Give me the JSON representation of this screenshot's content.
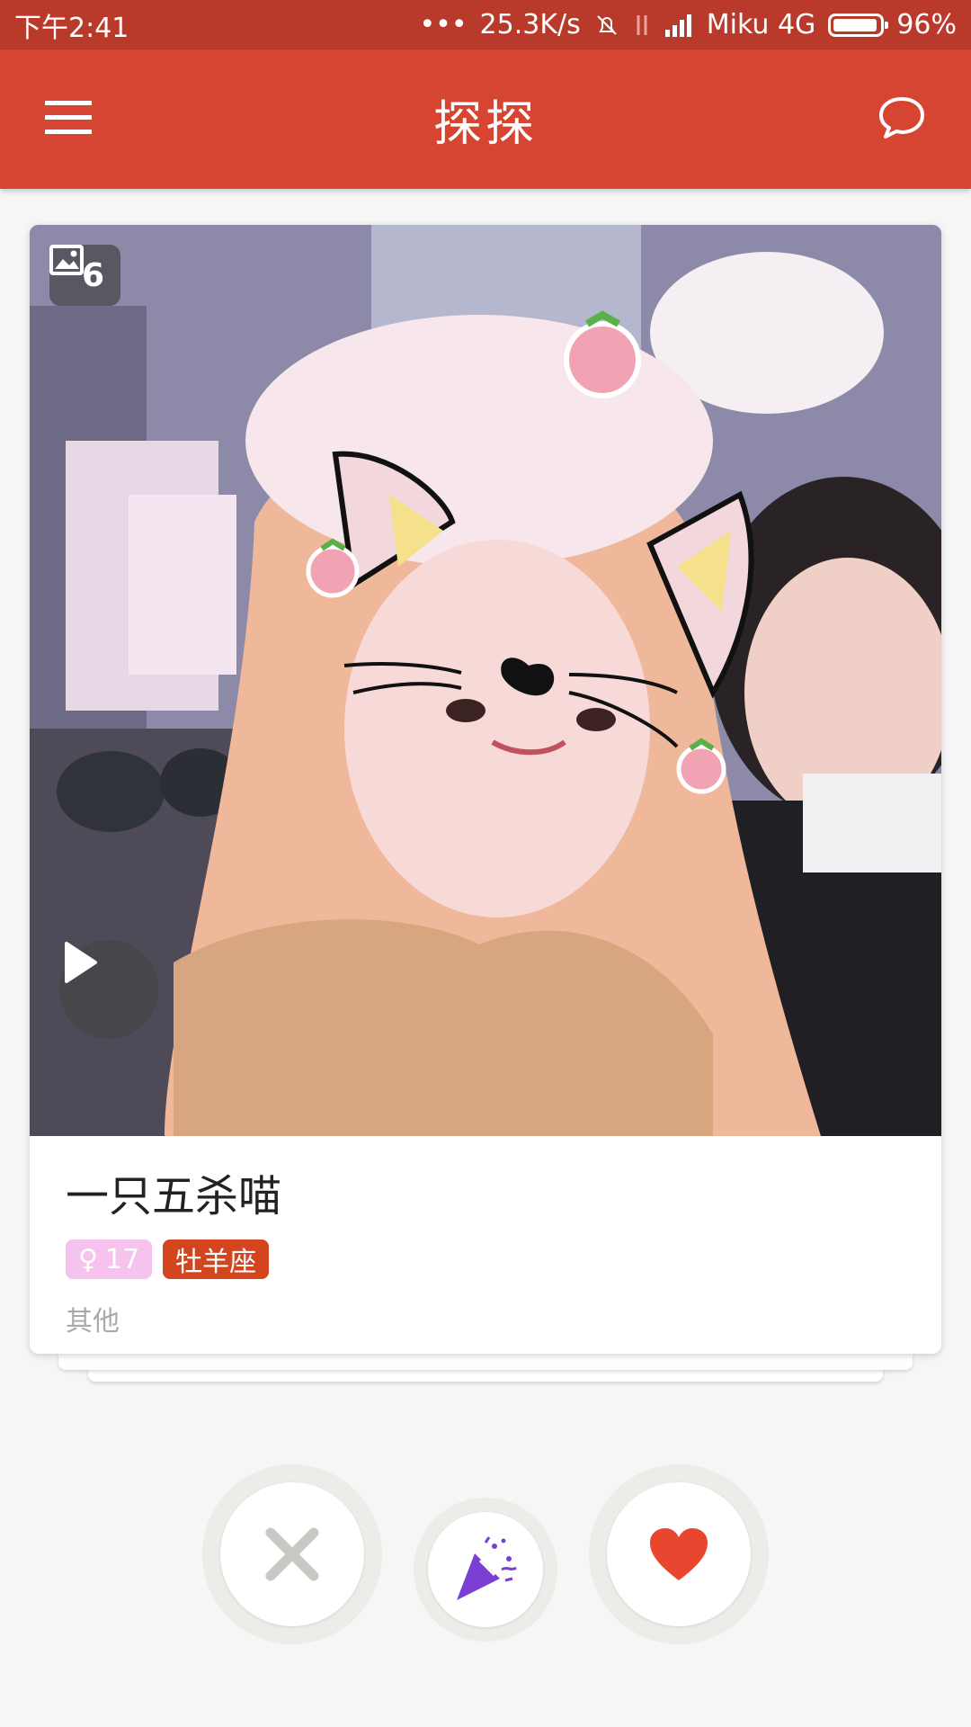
{
  "status_bar": {
    "time": "下午2:41",
    "network_speed": "25.3K/s",
    "carrier": "Miku 4G",
    "battery": "96%",
    "battery_level": 0.96
  },
  "app_bar": {
    "title": "探探",
    "menu_icon": "hamburger-menu-icon",
    "chat_icon": "chat-bubble-icon"
  },
  "card": {
    "photo_count": "6",
    "name": "一只五杀喵",
    "gender_symbol": "♀",
    "age": "17",
    "zodiac": "牡羊座",
    "occupation": "其他",
    "colors": {
      "age_tag": "#f6c3ee",
      "zodiac_tag": "#d2451f"
    }
  },
  "actions": {
    "dislike_icon": "close-icon",
    "superlike_icon": "party-popper-icon",
    "like_icon": "heart-icon",
    "colors": {
      "like": "#e8462e",
      "dislike": "#c8c8c4",
      "superlike": "#7b3fd6"
    }
  }
}
